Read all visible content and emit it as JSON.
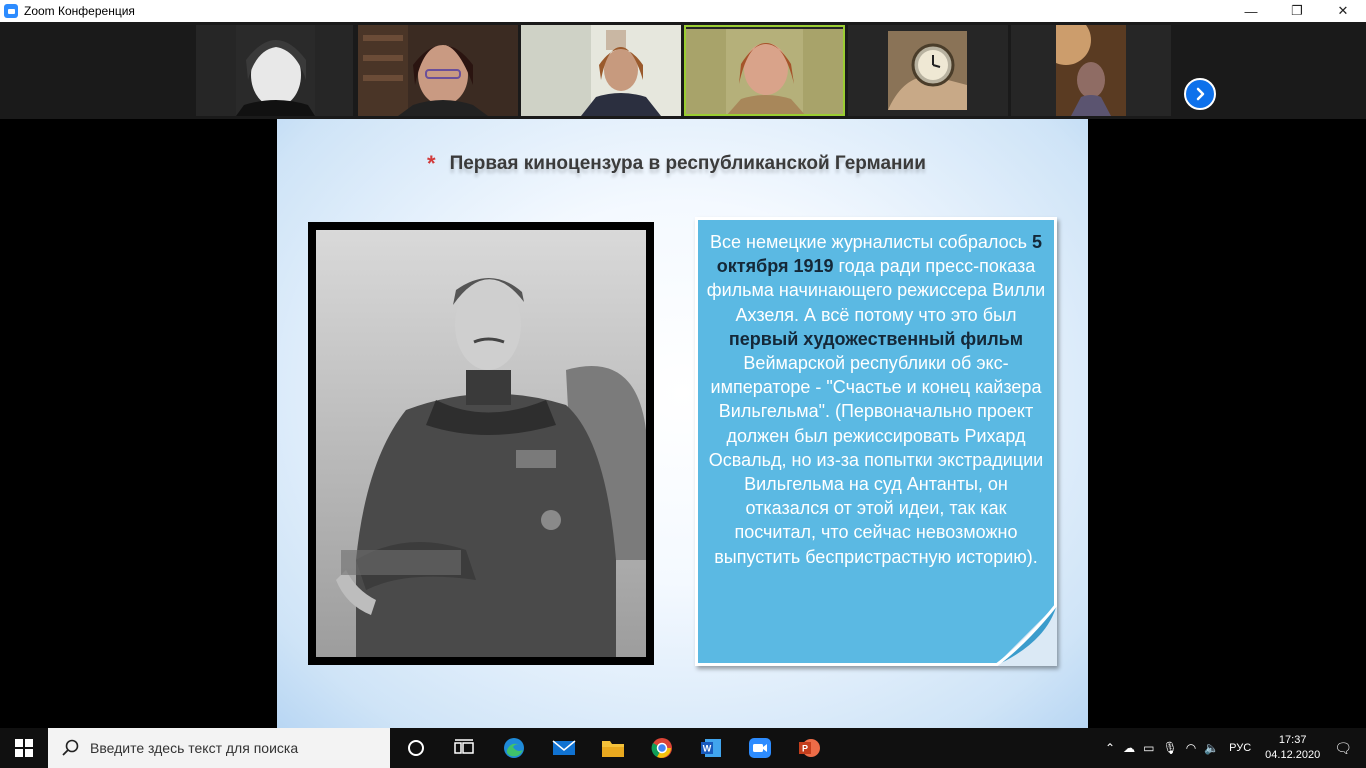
{
  "window": {
    "title": "Zoom Конференция",
    "controls": [
      "—",
      "❐",
      "✕"
    ]
  },
  "participants": [
    "participant-1",
    "participant-2",
    "participant-3",
    "participant-4",
    "participant-5",
    "participant-6"
  ],
  "slide": {
    "bullet": "*",
    "title": "Первая киноцензура в республиканской Германии",
    "text": {
      "part1": "Все немецкие журналисты собралось ",
      "date": "5 октября 1919",
      "part2": " года ради пресс-показа фильма начинающего режиссера Вилли Ахзеля. А всё потому что это был ",
      "bold1": "первый художественный фильм",
      "part3": " Веймарской республики об экс-императоре - \"Счастье и конец кайзера Вильгельма\". (Первоначально проект должен был режиссировать Рихард Освальд, но из-за попытки экстрадиции Вильгельма на суд Антанты, он отказался от этой идеи, так как посчитал, что сейчас невозможно выпустить беспристрастную историю)."
    }
  },
  "taskbar": {
    "search_placeholder": "Введите здесь текст для поиска",
    "lang": "РУС",
    "time": "17:37",
    "date": "04.12.2020"
  },
  "colors": {
    "slide_textbox": "#5bb9e3",
    "title_star": "#d23a3a",
    "zoom_blue": "#0e71eb"
  }
}
